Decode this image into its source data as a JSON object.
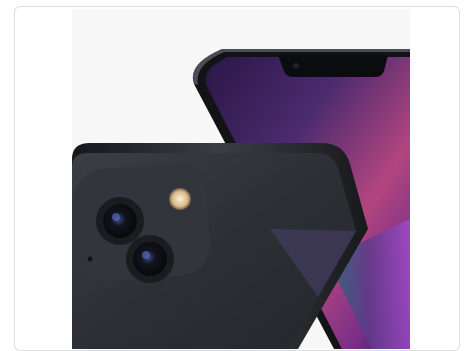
{
  "product_image": {
    "subject": "phone-product-photo",
    "colors": {
      "frame_background": "#f7f7f7",
      "phone_body": "#2e3136",
      "phone_edge": "#1c1e22",
      "screen_purple": "#4b2a6e",
      "screen_magenta": "#b2457f",
      "camera_lens": "#0c0e12",
      "flash": "#e8d2a8"
    }
  }
}
